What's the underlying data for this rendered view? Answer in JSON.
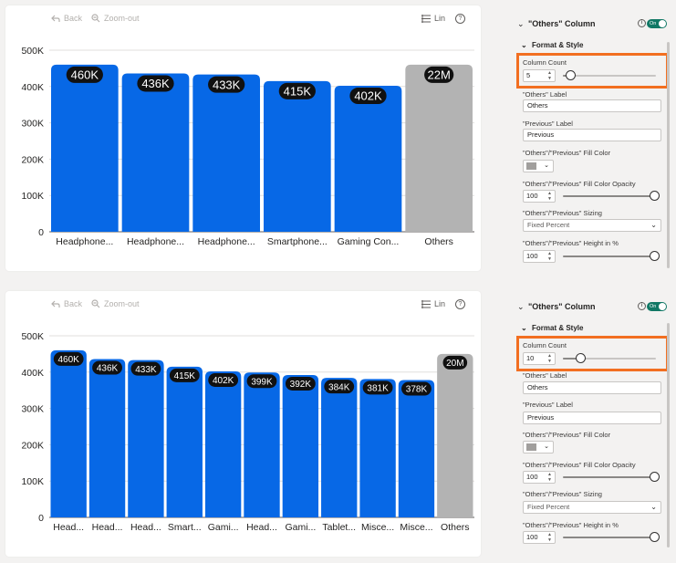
{
  "toolbar": {
    "back_label": "Back",
    "zoom_out_label": "Zoom-out",
    "scale_label": "Lin",
    "help_label": "?"
  },
  "chart_data": [
    {
      "type": "bar",
      "categories": [
        "Headphone...",
        "Headphone...",
        "Headphone...",
        "Smartphone...",
        "Gaming Con...",
        "Others"
      ],
      "values": [
        460000,
        436000,
        433000,
        415000,
        402000,
        460000
      ],
      "data_labels": [
        "460K",
        "436K",
        "433K",
        "415K",
        "402K",
        "22M"
      ],
      "y_ticks": [
        "0",
        "100K",
        "200K",
        "300K",
        "400K",
        "500K"
      ],
      "ylim": [
        0,
        500000
      ],
      "bar_colors": [
        "#0768e6",
        "#0768e6",
        "#0768e6",
        "#0768e6",
        "#0768e6",
        "#b3b3b3"
      ],
      "grid": true
    },
    {
      "type": "bar",
      "categories": [
        "Head...",
        "Head...",
        "Head...",
        "Smart...",
        "Gami...",
        "Head...",
        "Gami...",
        "Tablet...",
        "Misce...",
        "Misce...",
        "Others"
      ],
      "values": [
        460000,
        436000,
        433000,
        415000,
        402000,
        399000,
        392000,
        384000,
        381000,
        378000,
        450000
      ],
      "data_labels": [
        "460K",
        "436K",
        "433K",
        "415K",
        "402K",
        "399K",
        "392K",
        "384K",
        "381K",
        "378K",
        "20M"
      ],
      "y_ticks": [
        "0",
        "100K",
        "200K",
        "300K",
        "400K",
        "500K"
      ],
      "ylim": [
        0,
        500000
      ],
      "bar_colors": [
        "#0768e6",
        "#0768e6",
        "#0768e6",
        "#0768e6",
        "#0768e6",
        "#0768e6",
        "#0768e6",
        "#0768e6",
        "#0768e6",
        "#0768e6",
        "#b3b3b3"
      ],
      "grid": true
    }
  ],
  "panels": [
    {
      "header_title": "\"Others\" Column",
      "toggle_label": "On",
      "section_title": "Format & Style",
      "column_count_label": "Column Count",
      "column_count_value": "5",
      "column_count_slider_fraction": 0.05,
      "others_label_label": "\"Others\" Label",
      "others_label_value": "Others",
      "previous_label_label": "\"Previous\" Label",
      "previous_label_value": "Previous",
      "fill_color_label": "\"Others\"/\"Previous\" Fill Color",
      "fill_color_value": "#a19f9d",
      "opacity_label": "\"Others\"/\"Previous\" Fill Color Opacity",
      "opacity_value": "100",
      "sizing_label": "\"Others\"/\"Previous\" Sizing",
      "sizing_value": "Fixed Percent",
      "height_label": "\"Others\"/\"Previous\" Height in %",
      "height_value": "100"
    },
    {
      "header_title": "\"Others\" Column",
      "toggle_label": "On",
      "section_title": "Format & Style",
      "column_count_label": "Column Count",
      "column_count_value": "10",
      "column_count_slider_fraction": 0.1,
      "others_label_label": "\"Others\" Label",
      "others_label_value": "Others",
      "previous_label_label": "\"Previous\" Label",
      "previous_label_value": "Previous",
      "fill_color_label": "\"Others\"/\"Previous\" Fill Color",
      "fill_color_value": "#a19f9d",
      "opacity_label": "\"Others\"/\"Previous\" Fill Color Opacity",
      "opacity_value": "100",
      "sizing_label": "\"Others\"/\"Previous\" Sizing",
      "sizing_value": "Fixed Percent",
      "height_label": "\"Others\"/\"Previous\" Height in %",
      "height_value": "100"
    }
  ],
  "colors": {
    "highlight": "#f26f21",
    "toggle_on": "#117865",
    "bar": "#0768e6",
    "others_bar": "#b3b3b3"
  }
}
